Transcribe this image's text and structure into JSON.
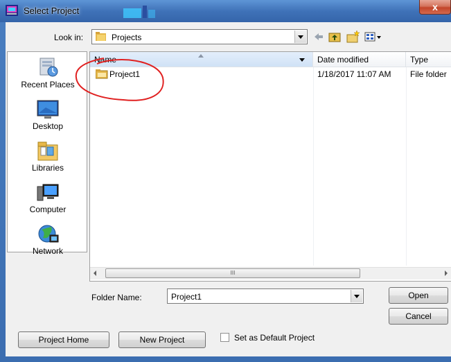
{
  "window": {
    "title": "Select Project",
    "close_label": "x"
  },
  "lookin": {
    "label": "Look in:",
    "value": "Projects"
  },
  "places": [
    {
      "label": "Recent Places",
      "icon": "recent-places-icon"
    },
    {
      "label": "Desktop",
      "icon": "desktop-icon"
    },
    {
      "label": "Libraries",
      "icon": "libraries-icon"
    },
    {
      "label": "Computer",
      "icon": "computer-icon"
    },
    {
      "label": "Network",
      "icon": "network-icon"
    }
  ],
  "columns": {
    "name": "Name",
    "date": "Date modified",
    "type": "Type"
  },
  "files": [
    {
      "name": "Project1",
      "date": "1/18/2017 11:07 AM",
      "type": "File folder"
    }
  ],
  "scrollbar": {
    "grip": "III"
  },
  "folder_name": {
    "label": "Folder Name:",
    "value": "Project1"
  },
  "buttons": {
    "open": "Open",
    "cancel": "Cancel",
    "project_home": "Project Home",
    "new_project": "New Project"
  },
  "default_checkbox": {
    "label": "Set as Default Project",
    "checked": false
  },
  "colors": {
    "title_bar": "#3f72b8",
    "annotation_circle": "#e02020"
  }
}
